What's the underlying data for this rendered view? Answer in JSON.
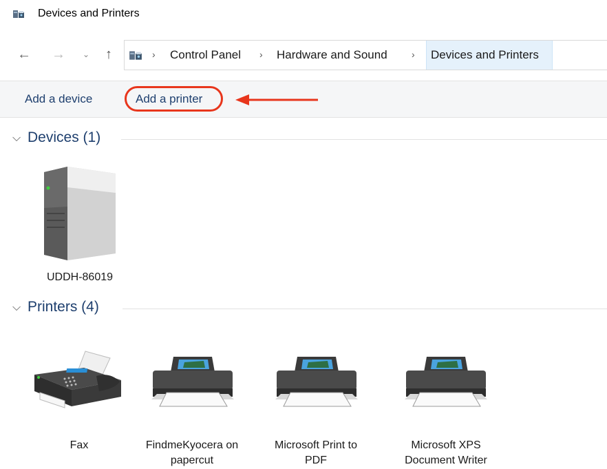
{
  "window": {
    "title": "Devices and Printers",
    "title_icon": "devices-printers-icon"
  },
  "navigation": {
    "back_icon": "arrow-left-icon",
    "forward_icon": "arrow-right-icon",
    "recent_icon": "chevron-down-icon",
    "up_icon": "arrow-up-icon",
    "separator": "›",
    "breadcrumbs": [
      "Control Panel",
      "Hardware and Sound",
      "Devices and Printers"
    ]
  },
  "commands": {
    "add_device": "Add a device",
    "add_printer": "Add a printer",
    "highlight_color": "#e8361c"
  },
  "groups": {
    "devices": {
      "title": "Devices (1)",
      "items": [
        {
          "label": "UDDH-86019",
          "icon": "computer-tower-icon"
        }
      ]
    },
    "printers": {
      "title": "Printers (4)",
      "items": [
        {
          "label": "Fax",
          "icon": "fax-icon"
        },
        {
          "label": "FindmeKyocera on papercut",
          "icon": "printer-icon"
        },
        {
          "label": "Microsoft Print to PDF",
          "icon": "printer-icon"
        },
        {
          "label": "Microsoft XPS Document Writer",
          "icon": "printer-icon"
        }
      ]
    }
  },
  "colors": {
    "accent": "#1e3f6e",
    "address_selected": "#e5f1fb",
    "command_bar": "#f5f6f7"
  }
}
